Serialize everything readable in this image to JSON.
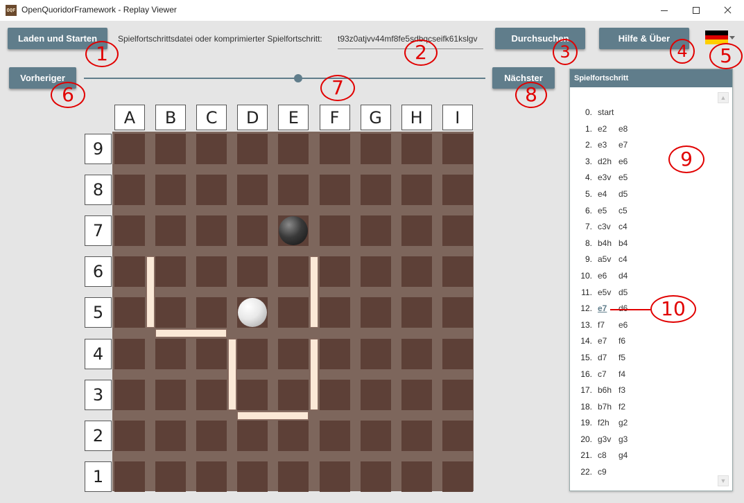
{
  "window": {
    "icon_text": "OQF",
    "title": "OpenQuoridorFramework - Replay Viewer"
  },
  "toolbar": {
    "load_label": "Laden und Starten",
    "path_label": "Spielfortschrittsdatei oder komprimierter Spielfortschritt:",
    "path_value": "t93z0atjvv44mf8fe5sdbqcseifk61kslgv",
    "browse_label": "Durchsuchen",
    "help_label": "Hilfe & Über",
    "language_flag": {
      "icon": "flag-germany-icon",
      "colors": [
        "#000000",
        "#dd0000",
        "#ffce00"
      ]
    }
  },
  "navigation": {
    "previous_label": "Vorheriger",
    "next_label": "Nächster",
    "slider_position": 0.53
  },
  "board": {
    "columns": [
      "A",
      "B",
      "C",
      "D",
      "E",
      "F",
      "G",
      "H",
      "I"
    ],
    "rows": [
      "9",
      "8",
      "7",
      "6",
      "5",
      "4",
      "3",
      "2",
      "1"
    ],
    "cell_color": "#5d4037",
    "groove_color": "#7d665c",
    "wall_color": "#fbe9d7",
    "pawns": [
      {
        "color": "black",
        "square": "e7"
      },
      {
        "color": "white",
        "square": "d5"
      }
    ],
    "walls": [
      "a5v",
      "b4h",
      "c3v",
      "d2h",
      "e5v",
      "e3v"
    ]
  },
  "history": {
    "header": "Spielfortschritt",
    "moves": [
      {
        "num": "0.",
        "a": "start",
        "b": ""
      },
      {
        "num": "1.",
        "a": "e2",
        "b": "e8"
      },
      {
        "num": "2.",
        "a": "e3",
        "b": "e7"
      },
      {
        "num": "3.",
        "a": "d2h",
        "b": "e6"
      },
      {
        "num": "4.",
        "a": "e3v",
        "b": "e5"
      },
      {
        "num": "5.",
        "a": "e4",
        "b": "d5"
      },
      {
        "num": "6.",
        "a": "e5",
        "b": "c5"
      },
      {
        "num": "7.",
        "a": "c3v",
        "b": "c4"
      },
      {
        "num": "8.",
        "a": "b4h",
        "b": "b4"
      },
      {
        "num": "9.",
        "a": "a5v",
        "b": "c4"
      },
      {
        "num": "10.",
        "a": "e6",
        "b": "d4"
      },
      {
        "num": "11.",
        "a": "e5v",
        "b": "d5"
      },
      {
        "num": "12.",
        "a": "e7",
        "b": "d6"
      },
      {
        "num": "13.",
        "a": "f7",
        "b": "e6"
      },
      {
        "num": "14.",
        "a": "e7",
        "b": "f6"
      },
      {
        "num": "15.",
        "a": "d7",
        "b": "f5"
      },
      {
        "num": "16.",
        "a": "c7",
        "b": "f4"
      },
      {
        "num": "17.",
        "a": "b6h",
        "b": "f3"
      },
      {
        "num": "18.",
        "a": "b7h",
        "b": "f2"
      },
      {
        "num": "19.",
        "a": "f2h",
        "b": "g2"
      },
      {
        "num": "20.",
        "a": "g3v",
        "b": "g3"
      },
      {
        "num": "21.",
        "a": "c8",
        "b": "g4"
      },
      {
        "num": "22.",
        "a": "c9",
        "b": ""
      }
    ],
    "active_index": 12
  },
  "annotations": {
    "color": "#e10000",
    "labels": [
      "1",
      "2",
      "3",
      "4",
      "5",
      "6",
      "7",
      "8",
      "9",
      "10"
    ]
  }
}
